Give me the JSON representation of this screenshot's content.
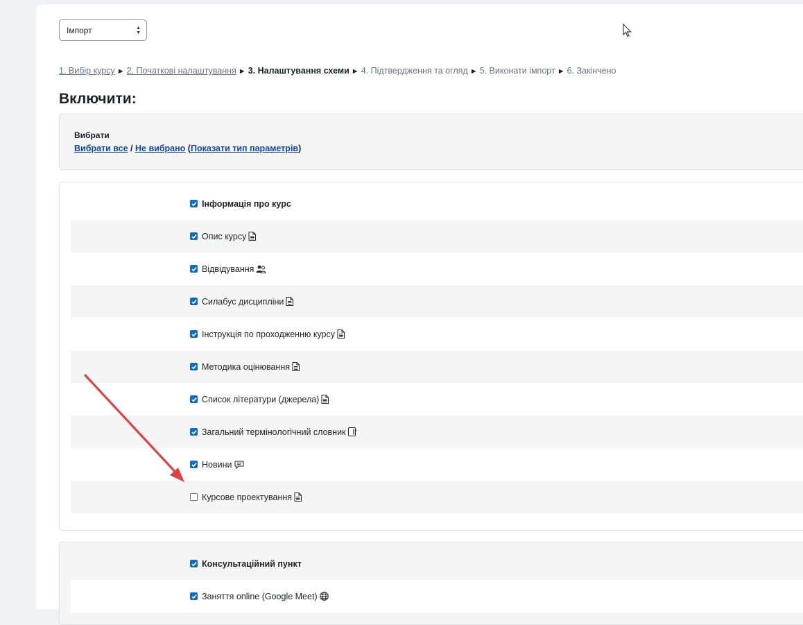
{
  "import_select": {
    "value": "Імпорт"
  },
  "breadcrumb": [
    {
      "label": "1. Вибір курсу",
      "state": "link"
    },
    {
      "label": "2. Початкові налаштування",
      "state": "link"
    },
    {
      "label": "3. Налаштування схеми",
      "state": "current"
    },
    {
      "label": "4. Підтвердження та огляд",
      "state": "pending"
    },
    {
      "label": "5. Виконати імпорт",
      "state": "pending"
    },
    {
      "label": "6. Закінчено",
      "state": "pending"
    }
  ],
  "breadcrumb_separator": "►",
  "heading": "Включити:",
  "select_box": {
    "title": "Вибрати",
    "select_all": "Вибрати все",
    "slash": " / ",
    "select_none": "Не вибрано",
    "open_paren": " (",
    "show_types": "Показати тип параметрів",
    "close_paren": ")"
  },
  "section1": {
    "items": [
      {
        "label": "Інформація про курс",
        "checked": true,
        "bold": true,
        "icon": ""
      },
      {
        "label": "Опис курсу",
        "checked": true,
        "bold": false,
        "icon": "page-icon"
      },
      {
        "label": "Відвідування",
        "checked": true,
        "bold": false,
        "icon": "attendance-icon"
      },
      {
        "label": "Силабус дисципліни",
        "checked": true,
        "bold": false,
        "icon": "page-icon"
      },
      {
        "label": "Інструкція по проходженню курсу",
        "checked": true,
        "bold": false,
        "icon": "page-icon"
      },
      {
        "label": "Методика оцінювання",
        "checked": true,
        "bold": false,
        "icon": "page-icon"
      },
      {
        "label": "Список літератури (джерела)",
        "checked": true,
        "bold": false,
        "icon": "page-icon"
      },
      {
        "label": "Загальний термінологічний словник",
        "checked": true,
        "bold": false,
        "icon": "glossary-icon"
      },
      {
        "label": "Новини",
        "checked": true,
        "bold": false,
        "icon": "forum-icon"
      },
      {
        "label": "Курсове проектування",
        "checked": false,
        "bold": false,
        "icon": "page-icon"
      }
    ]
  },
  "section2": {
    "items": [
      {
        "label": "Консультаційний пункт",
        "checked": true,
        "bold": true,
        "icon": ""
      },
      {
        "label": "Заняття online (Google Meet)",
        "checked": true,
        "bold": false,
        "icon": "url-globe-icon"
      }
    ]
  },
  "colors": {
    "accent": "#0f6cbf",
    "link": "#0f47ad",
    "annotation_arrow": "#e04040"
  }
}
